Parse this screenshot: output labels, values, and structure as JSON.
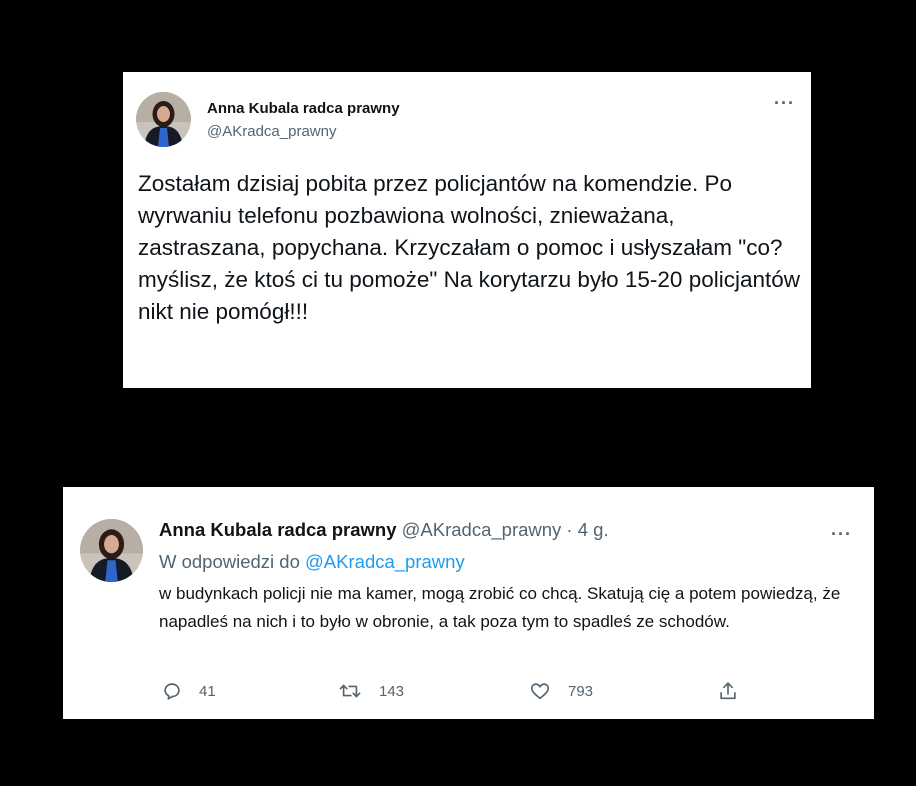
{
  "tweet_main": {
    "author_name": "Anna Kubala radca prawny",
    "author_handle": "@AKradca_prawny",
    "more_label": "···",
    "text": "Zostałam dzisiaj pobita przez policjantów na komendzie. Po wyrwaniu telefonu pozbawiona wolności, znieważana, zastraszana, popychana. Krzyczałam o pomoc i usłyszałam \"co? myślisz, że ktoś ci tu pomoże\" Na korytarzu było 15-20 policjantów nikt nie pomógł!!!"
  },
  "tweet_reply": {
    "author_name": "Anna Kubala radca prawny",
    "author_handle_time": "@AKradca_prawny · 4 g.",
    "more_label": "···",
    "reply_prefix": "W odpowiedzi do",
    "reply_to": "@AKradca_prawny",
    "text": "w budynkach policji nie ma kamer, mogą zrobić co chcą. Skatują cię a potem powiedzą, że napadleś na nich i to było w obronie, a tak poza tym to spadleś ze schodów.",
    "actions": {
      "replies": "41",
      "retweets": "143",
      "likes": "793"
    }
  },
  "colors": {
    "background": "#000000",
    "card": "#ffffff",
    "text": "#0f1419",
    "muted": "#536471",
    "link": "#1d9bf0"
  },
  "icons": [
    "avatar-photo",
    "more-icon",
    "reply-icon",
    "retweet-icon",
    "like-icon",
    "share-icon"
  ]
}
